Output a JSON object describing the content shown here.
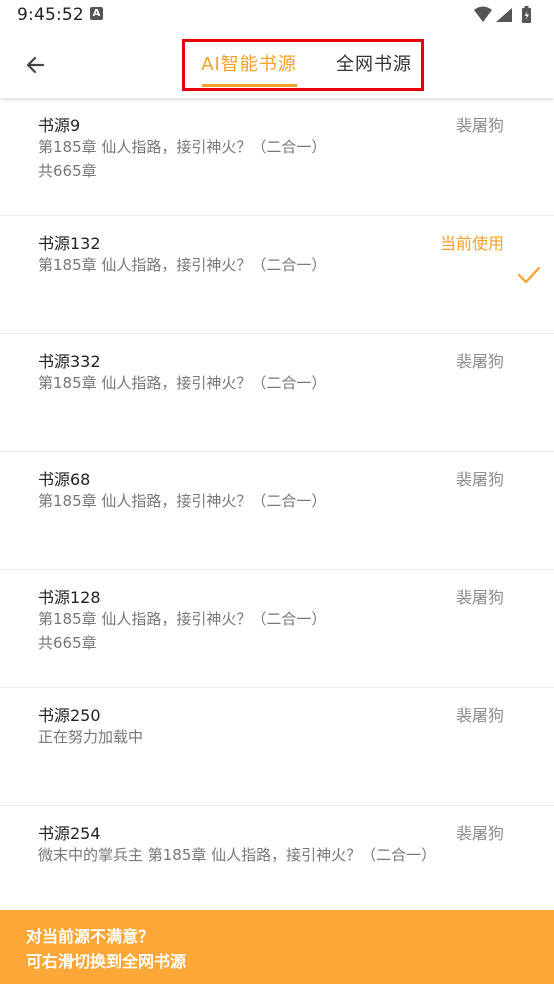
{
  "status_bar": {
    "time": "9:45:52",
    "notification_letter": "A"
  },
  "header": {
    "tabs": [
      {
        "label": "AI智能书源",
        "active": true
      },
      {
        "label": "全网书源",
        "active": false
      }
    ],
    "accent_color": "#f5a02a",
    "highlight_color": "#e8000b"
  },
  "sources": [
    {
      "title": "书源9",
      "latest": "第185章 仙人指路，接引神火？（二合一）",
      "count": "共665章",
      "right": "裴屠狗",
      "current": false
    },
    {
      "title": "书源132",
      "latest": "第185章 仙人指路，接引神火？（二合一）",
      "count": "",
      "right": "当前使用",
      "current": true
    },
    {
      "title": "书源332",
      "latest": "第185章 仙人指路，接引神火？（二合一）",
      "count": "",
      "right": "裴屠狗",
      "current": false
    },
    {
      "title": "书源68",
      "latest": "第185章 仙人指路，接引神火？（二合一）",
      "count": "",
      "right": "裴屠狗",
      "current": false
    },
    {
      "title": "书源128",
      "latest": "第185章 仙人指路，接引神火？（二合一）",
      "count": "共665章",
      "right": "裴屠狗",
      "current": false
    },
    {
      "title": "书源250",
      "latest": "正在努力加载中",
      "count": "",
      "right": "裴屠狗",
      "current": false
    },
    {
      "title": "书源254",
      "latest": "微末中的掌兵主 第185章 仙人指路，接引神火？（二合一）",
      "count": "",
      "right": "裴屠狗",
      "current": false
    }
  ],
  "banner": {
    "line1": "对当前源不满意？",
    "line2": "可右滑切换到全网书源",
    "color": "#fca737"
  }
}
